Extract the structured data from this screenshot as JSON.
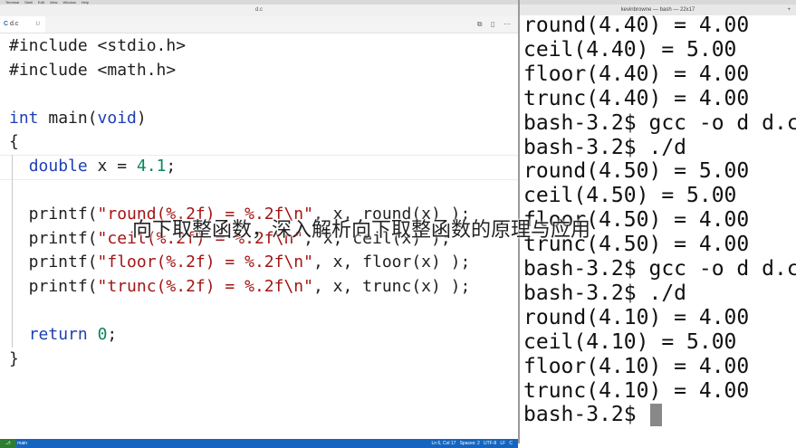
{
  "menubar": {
    "items": [
      "Terminal",
      "Shell",
      "Edit",
      "View",
      "Window",
      "Help"
    ]
  },
  "editor": {
    "window_title": "d.c",
    "tab": {
      "icon": "c-file-icon",
      "icon_glyph": "C",
      "label": "d.c",
      "modified": "U"
    },
    "code_lines": [
      {
        "tokens": [
          {
            "t": "#include <stdio.h>",
            "c": ""
          }
        ]
      },
      {
        "tokens": [
          {
            "t": "#include <math.h>",
            "c": ""
          }
        ]
      },
      {
        "tokens": []
      },
      {
        "tokens": [
          {
            "t": "int",
            "c": "ty"
          },
          {
            "t": " main(",
            "c": ""
          },
          {
            "t": "void",
            "c": "ty"
          },
          {
            "t": ")",
            "c": ""
          }
        ]
      },
      {
        "tokens": [
          {
            "t": "{",
            "c": ""
          }
        ]
      },
      {
        "tokens": [
          {
            "t": "  ",
            "c": ""
          },
          {
            "t": "double",
            "c": "ty"
          },
          {
            "t": " x = ",
            "c": ""
          },
          {
            "t": "4.1",
            "c": "nm"
          },
          {
            "t": ";",
            "c": ""
          }
        ]
      },
      {
        "tokens": []
      },
      {
        "tokens": [
          {
            "t": "  printf(",
            "c": ""
          },
          {
            "t": "\"round(%.2f) = %.2f\\n\"",
            "c": "st"
          },
          {
            "t": ", x, round(x) );",
            "c": ""
          }
        ]
      },
      {
        "tokens": [
          {
            "t": "  printf(",
            "c": ""
          },
          {
            "t": "\"ceil(%.2f) = %.2f\\n\"",
            "c": "st"
          },
          {
            "t": ", x, ceil(x) );",
            "c": ""
          }
        ]
      },
      {
        "tokens": [
          {
            "t": "  printf(",
            "c": ""
          },
          {
            "t": "\"floor(%.2f) = %.2f\\n\"",
            "c": "st"
          },
          {
            "t": ", x, floor(x) );",
            "c": ""
          }
        ]
      },
      {
        "tokens": [
          {
            "t": "  printf(",
            "c": ""
          },
          {
            "t": "\"trunc(%.2f) = %.2f\\n\"",
            "c": "st"
          },
          {
            "t": ", x, trunc(x) );",
            "c": ""
          }
        ]
      },
      {
        "tokens": []
      },
      {
        "tokens": [
          {
            "t": "  ",
            "c": ""
          },
          {
            "t": "return",
            "c": "kw"
          },
          {
            "t": " ",
            "c": ""
          },
          {
            "t": "0",
            "c": "nm"
          },
          {
            "t": ";",
            "c": ""
          }
        ]
      },
      {
        "tokens": [
          {
            "t": "}",
            "c": ""
          }
        ]
      }
    ],
    "status": {
      "branch": "main",
      "position": "Ln 6, Col 17",
      "spaces": "Spaces: 2",
      "encoding": "UTF-8",
      "eol": "LF",
      "language": "C"
    }
  },
  "terminal": {
    "title": "kevinbrowne — bash — 22x17",
    "lines": [
      "round(4.40) = 4.00",
      "ceil(4.40) = 5.00",
      "floor(4.40) = 4.00",
      "trunc(4.40) = 4.00",
      "bash-3.2$ gcc -o d d.c",
      "bash-3.2$ ./d",
      "round(4.50) = 5.00",
      "ceil(4.50) = 5.00",
      "floor(4.50) = 4.00",
      "trunc(4.50) = 4.00",
      "bash-3.2$ gcc -o d d.c",
      "bash-3.2$ ./d",
      "round(4.10) = 4.00",
      "ceil(4.10) = 5.00",
      "floor(4.10) = 4.00",
      "trunc(4.10) = 4.00"
    ],
    "prompt": "bash-3.2$ "
  },
  "overlay_caption": "向下取整函数，深入解析向下取整函数的原理与应用",
  "colors": {
    "keyword": "#1e3fb4",
    "string": "#a31515",
    "number": "#098658",
    "statusbar": "#1565c0"
  }
}
